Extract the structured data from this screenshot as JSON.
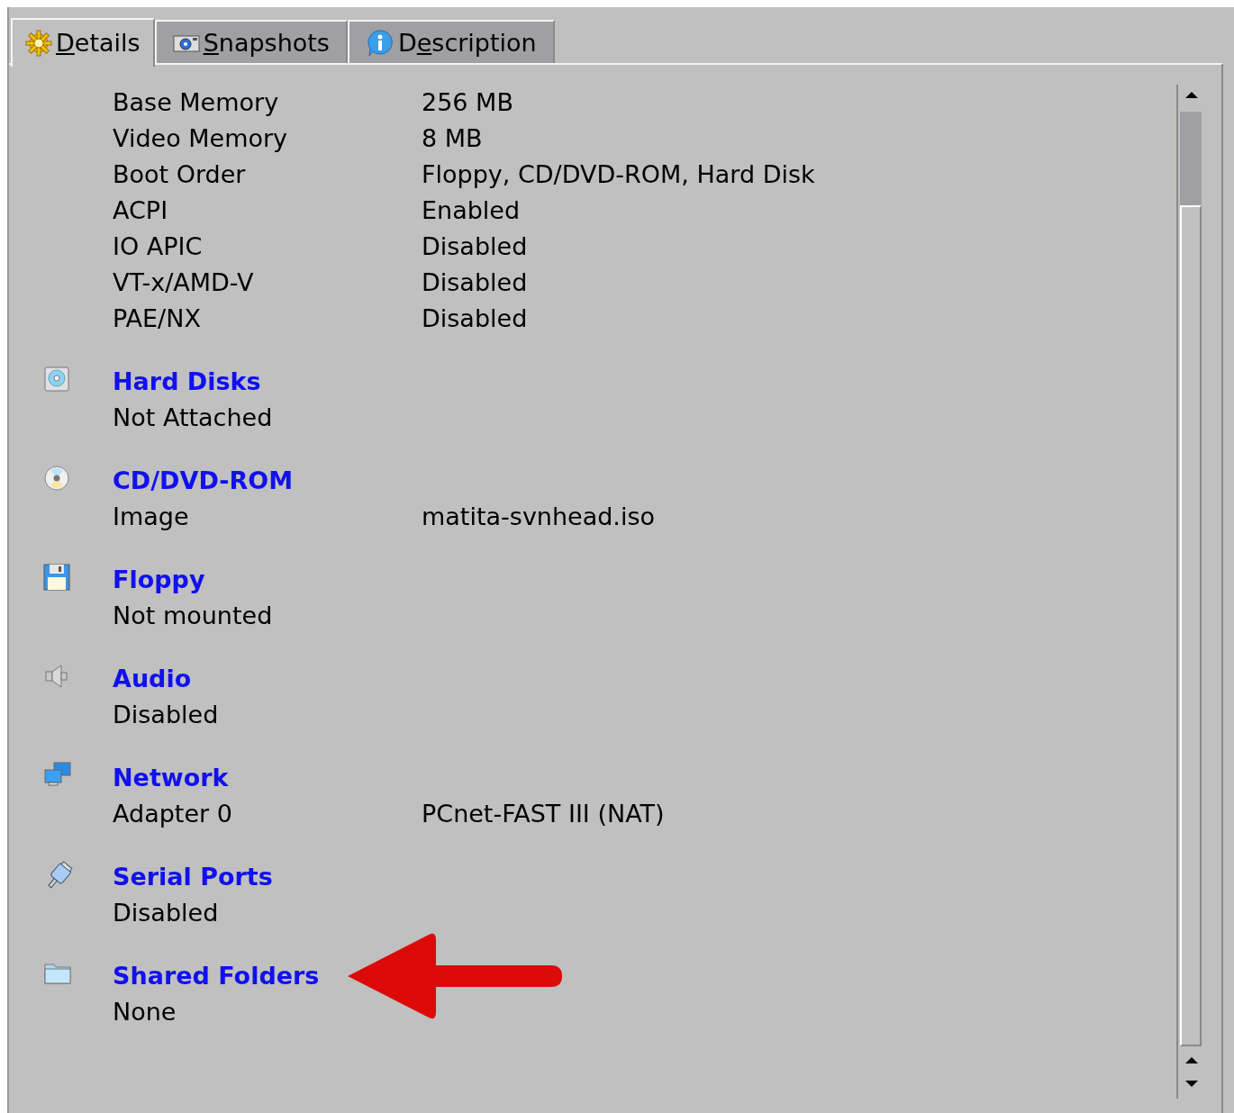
{
  "tabs": [
    {
      "label": "Details",
      "selected": true
    },
    {
      "label": "Snapshots",
      "selected": false
    },
    {
      "label": "Description",
      "selected": false
    }
  ],
  "sections": [
    {
      "rows": [
        {
          "label": "Base Memory",
          "value": "256 MB"
        },
        {
          "label": "Video Memory",
          "value": "8 MB"
        },
        {
          "label": "Boot Order",
          "value": "Floppy, CD/DVD-ROM, Hard Disk"
        },
        {
          "label": "ACPI",
          "value": "Enabled"
        },
        {
          "label": "IO APIC",
          "value": "Disabled"
        },
        {
          "label": "VT-x/AMD-V",
          "value": "Disabled"
        },
        {
          "label": "PAE/NX",
          "value": "Disabled"
        }
      ]
    },
    {
      "heading": "Hard Disks",
      "rows": [
        {
          "label": "Not Attached"
        }
      ]
    },
    {
      "heading": "CD/DVD-ROM",
      "rows": [
        {
          "label": "Image",
          "value": "matita-svnhead.iso"
        }
      ]
    },
    {
      "heading": "Floppy",
      "rows": [
        {
          "label": "Not mounted"
        }
      ]
    },
    {
      "heading": "Audio",
      "rows": [
        {
          "label": "Disabled"
        }
      ]
    },
    {
      "heading": "Network",
      "rows": [
        {
          "label": "Adapter 0",
          "value": "PCnet-FAST III (NAT)"
        }
      ]
    },
    {
      "heading": "Serial Ports",
      "rows": [
        {
          "label": "Disabled"
        }
      ]
    },
    {
      "heading": "Shared Folders",
      "rows": [
        {
          "label": "None"
        }
      ]
    }
  ]
}
